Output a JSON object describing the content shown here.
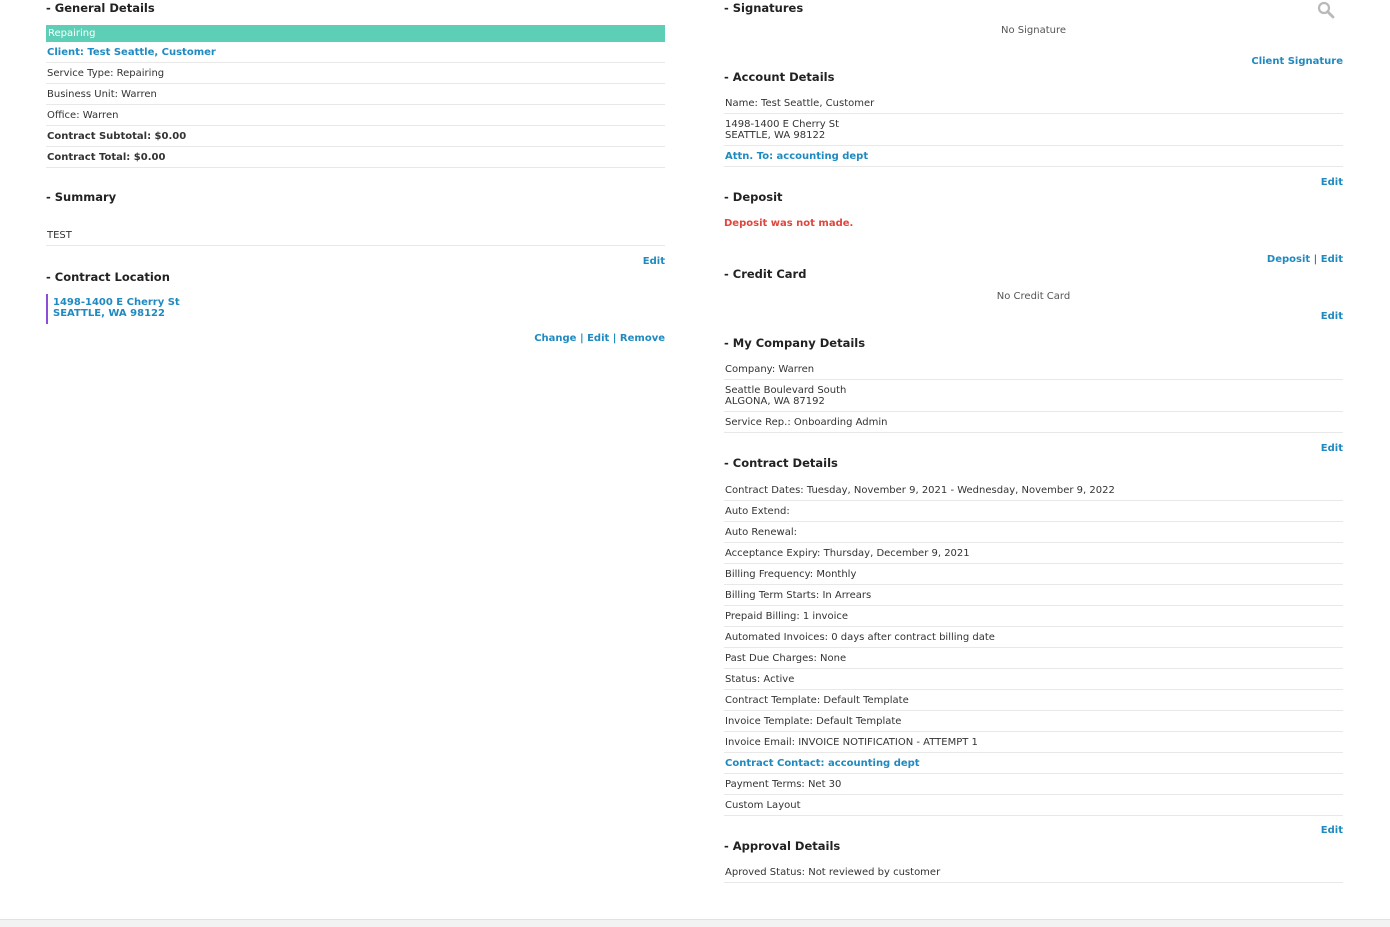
{
  "colors": {
    "accent_link": "#1f8ac0",
    "status_bar": "#5dcfb6",
    "warning": "#e0463c",
    "location_border": "#8a4fd6"
  },
  "general": {
    "title": "- General Details",
    "status_label": "Repairing",
    "client": "Client: Test Seattle, Customer",
    "service_type": "Service Type: Repairing",
    "business_unit": "Business Unit: Warren",
    "office": "Office: Warren",
    "subtotal": "Contract Subtotal: $0.00",
    "total": "Contract Total: $0.00"
  },
  "summary": {
    "title": "- Summary",
    "text": "TEST",
    "edit_label": "Edit"
  },
  "location": {
    "title": "- Contract Location",
    "line1": "1498-1400 E Cherry St",
    "line2": "SEATTLE, WA 98122",
    "change_label": "Change",
    "edit_label": "Edit",
    "remove_label": "Remove",
    "sep": "|"
  },
  "signatures": {
    "title": "- Signatures",
    "empty": "No Signature",
    "client_signature_label": "Client Signature",
    "icon": "search-icon"
  },
  "account": {
    "title": "- Account Details",
    "name": "Name: Test Seattle, Customer",
    "address1": "1498-1400 E Cherry St",
    "address2": "SEATTLE, WA 98122",
    "attn": "Attn. To: accounting dept",
    "edit_label": "Edit"
  },
  "deposit": {
    "title": "- Deposit",
    "status": "Deposit was not made.",
    "deposit_label": "Deposit",
    "sep": "|",
    "edit_label": "Edit"
  },
  "credit_card": {
    "title": "- Credit Card",
    "empty": "No Credit Card",
    "edit_label": "Edit"
  },
  "company": {
    "title": "- My Company Details",
    "company": "Company: Warren",
    "address1": "Seattle Boulevard South",
    "address2": "ALGONA, WA 87192",
    "service_rep": "Service Rep.: Onboarding Admin",
    "edit_label": "Edit"
  },
  "contract": {
    "title": "- Contract Details",
    "rows": [
      "Contract Dates: Tuesday, November 9, 2021 - Wednesday, November 9, 2022",
      "Auto Extend:",
      "Auto Renewal:",
      "Acceptance Expiry: Thursday, December 9, 2021",
      "Billing Frequency: Monthly",
      "Billing Term Starts: In Arrears",
      "Prepaid Billing: 1 invoice",
      "Automated Invoices: 0 days after contract billing date",
      "Past Due Charges: None",
      "Status: Active",
      "Contract Template: Default Template",
      "Invoice Template: Default Template",
      "Invoice Email: INVOICE NOTIFICATION - ATTEMPT 1",
      "Contract Contact: accounting dept",
      "Payment Terms: Net 30",
      "Custom Layout"
    ],
    "edit_label": "Edit"
  },
  "approval": {
    "title": "- Approval Details",
    "status": "Aproved Status: Not reviewed by customer"
  }
}
